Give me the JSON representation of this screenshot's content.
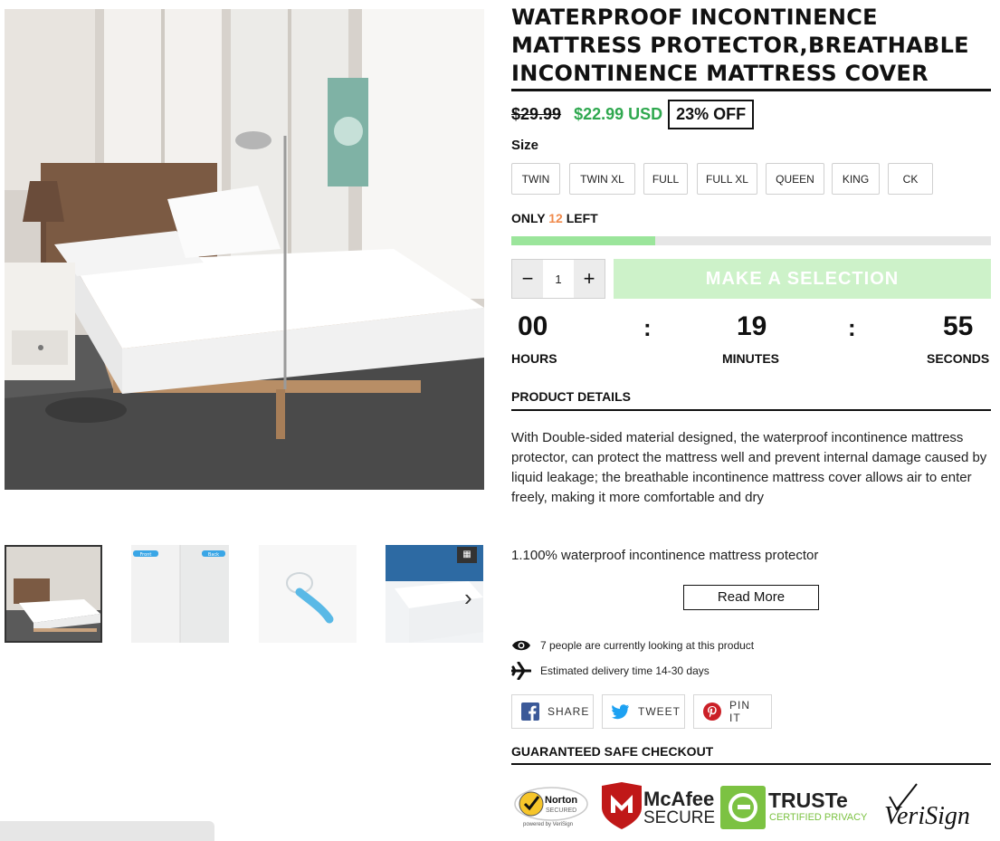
{
  "product": {
    "title": "WATERPROOF INCONTINENCE MATTRESS PROTECTOR,BREATHABLE INCONTINENCE MATTRESS COVER",
    "price_old": "$29.99",
    "price_new": "$22.99 USD",
    "discount": "23% OFF"
  },
  "size": {
    "label": "Size",
    "options": [
      "TWIN",
      "TWIN XL",
      "FULL",
      "FULL XL",
      "QUEEN",
      "KING",
      "CK"
    ]
  },
  "stock": {
    "prefix": "ONLY",
    "count": "12",
    "suffix": "LEFT",
    "fill_fraction": 0.3
  },
  "quantity": {
    "minus": "−",
    "value": "1",
    "plus": "+"
  },
  "add_button": "MAKE A SELECTION",
  "countdown": {
    "hours": "00",
    "minutes": "19",
    "seconds": "55",
    "separator": ":",
    "hours_label": "HOURS",
    "minutes_label": "MINUTES",
    "seconds_label": "SECONDS"
  },
  "details": {
    "heading": "PRODUCT DETAILS",
    "description": "With Double-sided material designed, the waterproof incontinence mattress protector, can protect the mattress well and prevent internal damage caused by liquid leakage; the breathable incontinence mattress cover allows air to enter freely, making it more comfortable and dry",
    "point1": "1.100% waterproof incontinence mattress protector",
    "read_more": "Read More"
  },
  "info": {
    "viewers": "7 people are currently looking at this product",
    "delivery": "Estimated delivery time 14-30 days"
  },
  "share": {
    "facebook": "SHARE",
    "twitter": "TWEET",
    "pinterest": "PIN IT"
  },
  "checkout": {
    "heading": "GUARANTEED SAFE CHECKOUT",
    "badges": {
      "norton": "Norton",
      "norton_sub": "SECURED",
      "norton_powered": "powered by VeriSign",
      "mcafee": "McAfee",
      "mcafee_sub": "SECURE",
      "truste": "TRUSTe",
      "truste_sub": "CERTIFIED PRIVACY",
      "verisign": "VeriSign"
    }
  },
  "gallery": {
    "thumb_count": 4,
    "front_label": "Front",
    "back_label": "Back"
  },
  "colors": {
    "sale": "#2fa84f",
    "stock_count": "#f08a4b",
    "stock_bar": "#9be59b",
    "select_button": "#cdf2c9"
  }
}
